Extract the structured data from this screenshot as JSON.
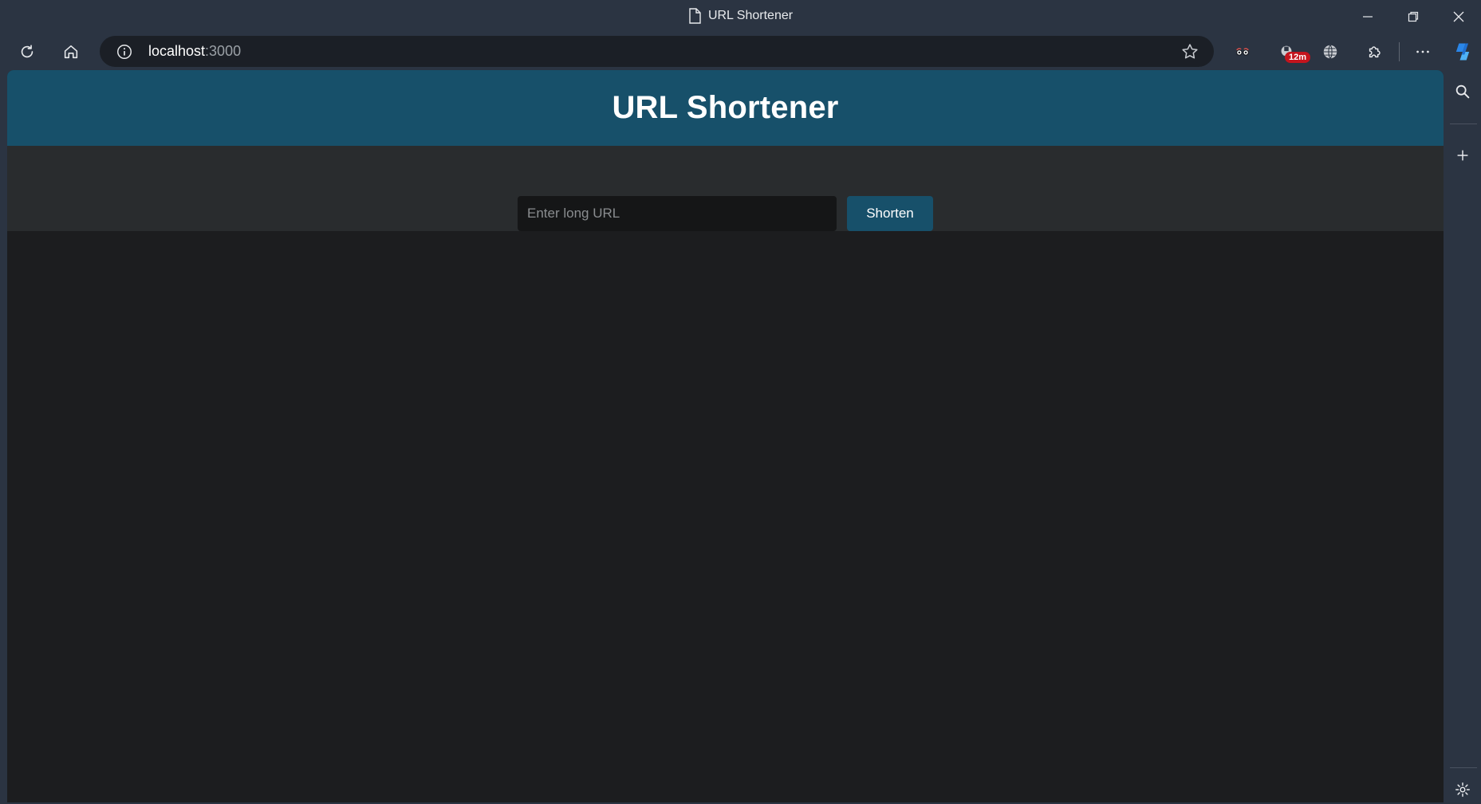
{
  "window": {
    "title": "URL Shortener"
  },
  "browser": {
    "address": {
      "host": "localhost",
      "port": ":3000"
    },
    "extension_badge": "12m",
    "icons": {
      "reload": "reload-icon",
      "home": "home-icon",
      "site_info": "info-icon",
      "favorite": "star-icon",
      "extensions": "puzzle-icon",
      "menu": "more-icon",
      "copilot": "copilot-icon",
      "sidebar_search": "search-icon",
      "sidebar_add": "plus-icon",
      "sidebar_settings": "gear-icon"
    }
  },
  "page": {
    "header_title": "URL Shortener",
    "input_placeholder": "Enter long URL",
    "button_label": "Shorten"
  },
  "colors": {
    "header_bg": "#17506a",
    "button_bg": "#17506a",
    "page_bg": "#1c1d1f",
    "form_band_bg": "#292c2e",
    "browser_chrome": "#2b3442"
  }
}
